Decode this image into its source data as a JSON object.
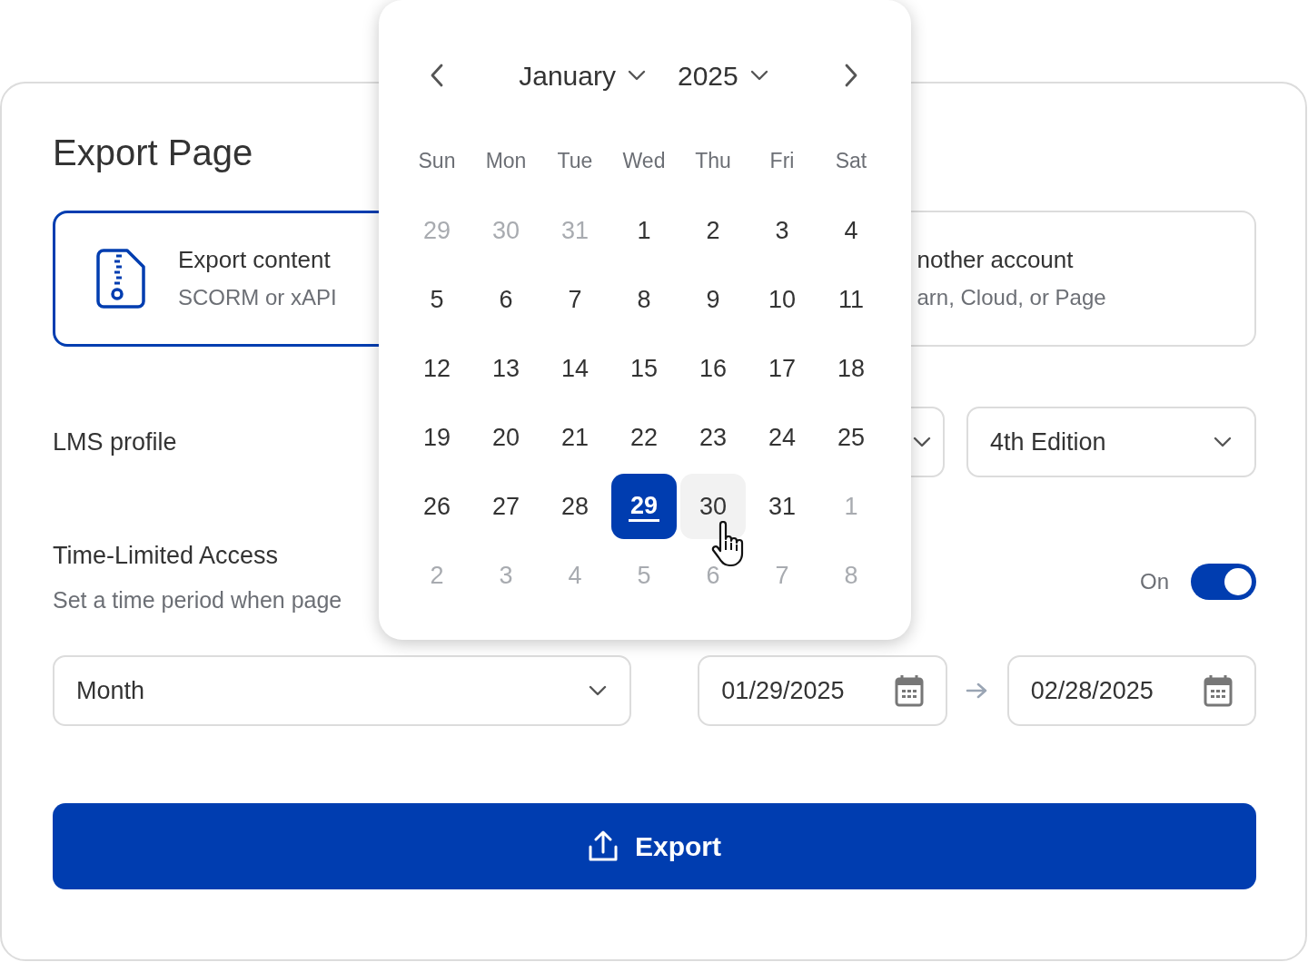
{
  "title": "Export Page",
  "export_options": [
    {
      "title": "Export content",
      "subtitle": "SCORM or xAPI",
      "selected": true
    },
    {
      "title": "nother account",
      "subtitle": "arn, Cloud, or Page",
      "selected": false
    }
  ],
  "lms_profile": {
    "label": "LMS profile",
    "edition": "4th Edition"
  },
  "time_limited": {
    "title": "Time-Limited Access",
    "description": "Set a time period when page",
    "switch_label": "On",
    "on": true
  },
  "period": {
    "value": "Month"
  },
  "start_date": "01/29/2025",
  "end_date": "02/28/2025",
  "export_button": "Export",
  "calendar": {
    "month": "January",
    "year": "2025",
    "weekdays": [
      "Sun",
      "Mon",
      "Tue",
      "Wed",
      "Thu",
      "Fri",
      "Sat"
    ],
    "days": [
      {
        "label": "29",
        "outside": true,
        "selected": false,
        "today": false,
        "hovered": false
      },
      {
        "label": "30",
        "outside": true,
        "selected": false,
        "today": false,
        "hovered": false
      },
      {
        "label": "31",
        "outside": true,
        "selected": false,
        "today": false,
        "hovered": false
      },
      {
        "label": "1",
        "outside": false,
        "selected": false,
        "today": false,
        "hovered": false
      },
      {
        "label": "2",
        "outside": false,
        "selected": false,
        "today": false,
        "hovered": false
      },
      {
        "label": "3",
        "outside": false,
        "selected": false,
        "today": false,
        "hovered": false
      },
      {
        "label": "4",
        "outside": false,
        "selected": false,
        "today": false,
        "hovered": false
      },
      {
        "label": "5",
        "outside": false,
        "selected": false,
        "today": false,
        "hovered": false
      },
      {
        "label": "6",
        "outside": false,
        "selected": false,
        "today": false,
        "hovered": false
      },
      {
        "label": "7",
        "outside": false,
        "selected": false,
        "today": false,
        "hovered": false
      },
      {
        "label": "8",
        "outside": false,
        "selected": false,
        "today": false,
        "hovered": false
      },
      {
        "label": "9",
        "outside": false,
        "selected": false,
        "today": false,
        "hovered": false
      },
      {
        "label": "10",
        "outside": false,
        "selected": false,
        "today": false,
        "hovered": false
      },
      {
        "label": "11",
        "outside": false,
        "selected": false,
        "today": false,
        "hovered": false
      },
      {
        "label": "12",
        "outside": false,
        "selected": false,
        "today": false,
        "hovered": false
      },
      {
        "label": "13",
        "outside": false,
        "selected": false,
        "today": false,
        "hovered": false
      },
      {
        "label": "14",
        "outside": false,
        "selected": false,
        "today": false,
        "hovered": false
      },
      {
        "label": "15",
        "outside": false,
        "selected": false,
        "today": false,
        "hovered": false
      },
      {
        "label": "16",
        "outside": false,
        "selected": false,
        "today": false,
        "hovered": false
      },
      {
        "label": "17",
        "outside": false,
        "selected": false,
        "today": false,
        "hovered": false
      },
      {
        "label": "18",
        "outside": false,
        "selected": false,
        "today": false,
        "hovered": false
      },
      {
        "label": "19",
        "outside": false,
        "selected": false,
        "today": false,
        "hovered": false
      },
      {
        "label": "20",
        "outside": false,
        "selected": false,
        "today": false,
        "hovered": false
      },
      {
        "label": "21",
        "outside": false,
        "selected": false,
        "today": false,
        "hovered": false
      },
      {
        "label": "22",
        "outside": false,
        "selected": false,
        "today": false,
        "hovered": false
      },
      {
        "label": "23",
        "outside": false,
        "selected": false,
        "today": false,
        "hovered": false
      },
      {
        "label": "24",
        "outside": false,
        "selected": false,
        "today": false,
        "hovered": false
      },
      {
        "label": "25",
        "outside": false,
        "selected": false,
        "today": false,
        "hovered": false
      },
      {
        "label": "26",
        "outside": false,
        "selected": false,
        "today": false,
        "hovered": false
      },
      {
        "label": "27",
        "outside": false,
        "selected": false,
        "today": false,
        "hovered": false
      },
      {
        "label": "28",
        "outside": false,
        "selected": false,
        "today": false,
        "hovered": false
      },
      {
        "label": "29",
        "outside": false,
        "selected": true,
        "today": true,
        "hovered": false
      },
      {
        "label": "30",
        "outside": false,
        "selected": false,
        "today": false,
        "hovered": true
      },
      {
        "label": "31",
        "outside": false,
        "selected": false,
        "today": false,
        "hovered": false
      },
      {
        "label": "1",
        "outside": true,
        "selected": false,
        "today": false,
        "hovered": false
      },
      {
        "label": "2",
        "outside": true,
        "selected": false,
        "today": false,
        "hovered": false
      },
      {
        "label": "3",
        "outside": true,
        "selected": false,
        "today": false,
        "hovered": false
      },
      {
        "label": "4",
        "outside": true,
        "selected": false,
        "today": false,
        "hovered": false
      },
      {
        "label": "5",
        "outside": true,
        "selected": false,
        "today": false,
        "hovered": false
      },
      {
        "label": "6",
        "outside": true,
        "selected": false,
        "today": false,
        "hovered": false
      },
      {
        "label": "7",
        "outside": true,
        "selected": false,
        "today": false,
        "hovered": false
      },
      {
        "label": "8",
        "outside": true,
        "selected": false,
        "today": false,
        "hovered": false
      }
    ]
  }
}
